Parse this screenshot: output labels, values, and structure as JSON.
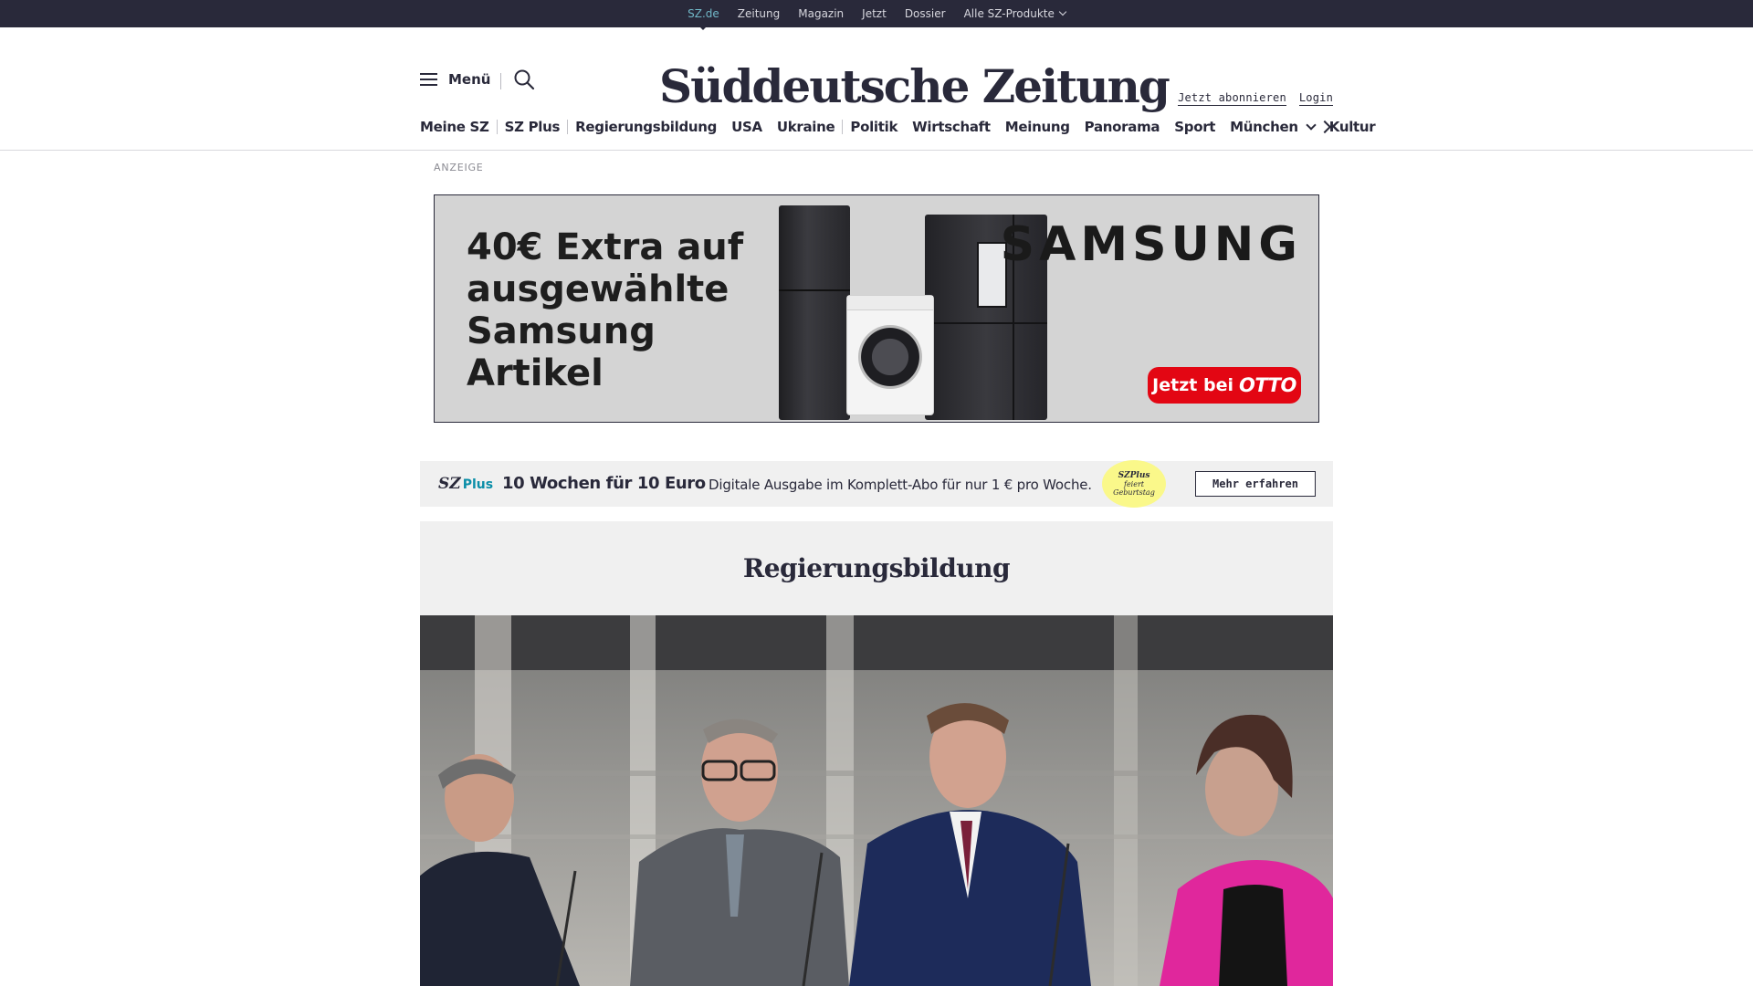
{
  "topbar": {
    "items": [
      "SZ.de",
      "Zeitung",
      "Magazin",
      "Jetzt",
      "Dossier",
      "Alle SZ-Produkte"
    ]
  },
  "header": {
    "menu_label": "Menü",
    "logo_text": "Süddeutsche Zeitung",
    "subscribe_link": "Jetzt abonnieren",
    "login_link": "Login"
  },
  "nav": {
    "items": [
      "Meine SZ",
      "SZ Plus",
      "Regierungsbildung",
      "USA",
      "Ukraine",
      "Politik",
      "Wirtschaft",
      "Meinung",
      "Panorama",
      "Sport",
      "München",
      "Kultur"
    ]
  },
  "ad": {
    "label": "ANZEIGE",
    "headline": "40€ Extra auf ausgewählte Samsung Artikel",
    "brand": "SAMSUNG",
    "cta_prefix": "Jetzt bei",
    "cta_brand": "OTTO"
  },
  "promo": {
    "logo_sz": "SZ",
    "logo_plus": "Plus",
    "title": "10 Wochen für 10 Euro",
    "description": "Digitale Ausgabe im Komplett-Abo für nur 1 € pro Woche.",
    "badge_line1": "SZPlus",
    "badge_line2": "feiert",
    "badge_line3": "Geburtstag",
    "button": "Mehr erfahren"
  },
  "section": {
    "title": "Regierungsbildung"
  },
  "colors": {
    "dark": "#29293a",
    "accent_teal": "#71b8c8",
    "otto_red": "#e30613",
    "badge_yellow": "#faf88a"
  }
}
